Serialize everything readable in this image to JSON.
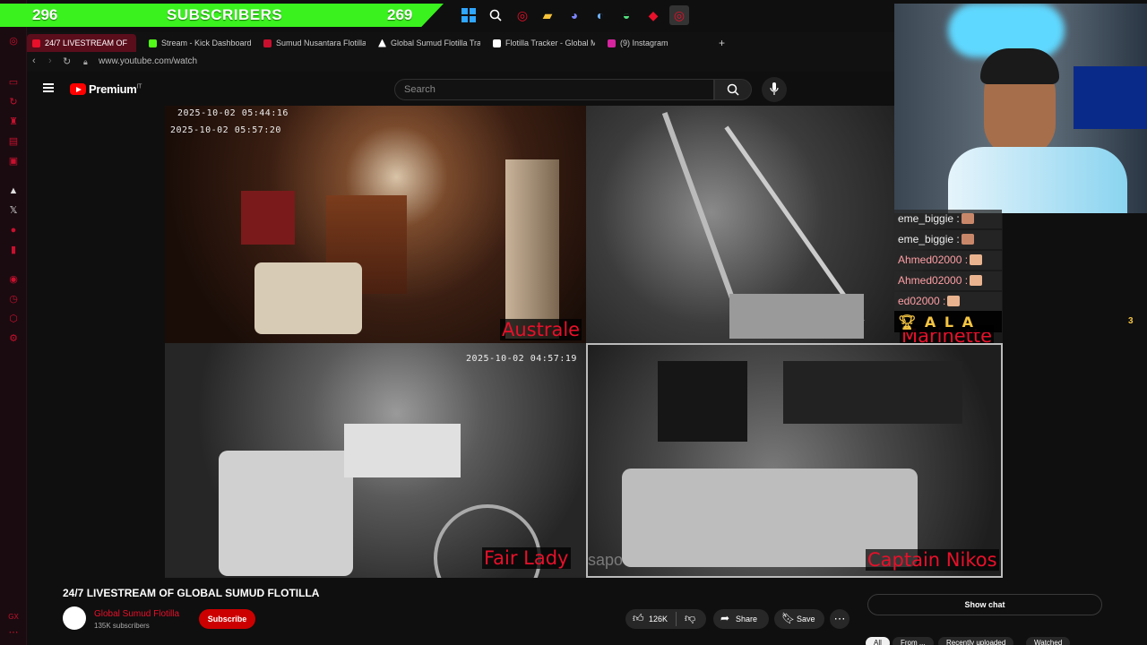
{
  "sub_bar": {
    "left_count": "296",
    "label": "SUBSCRIBERS",
    "right_count": "269"
  },
  "tabs": [
    {
      "label": "24/7 LIVESTREAM OF",
      "icon": "speaker-icon"
    },
    {
      "label": "Stream - Kick Dashboard",
      "icon": "kick-icon"
    },
    {
      "label": "Sumud Nusantara Flotilla",
      "icon": "flotilla-icon"
    },
    {
      "label": "Global Sumud Flotilla Tra",
      "icon": "triangle-icon"
    },
    {
      "label": "Flotilla Tracker - Global M",
      "icon": "page-icon"
    },
    {
      "label": "(9) Instagram",
      "icon": "instagram-icon"
    }
  ],
  "address": {
    "url": "www.youtube.com/watch"
  },
  "youtube": {
    "brand": "Premium",
    "brand_sup": "IT",
    "search_placeholder": "Search"
  },
  "video": {
    "cams": {
      "top_left": {
        "ts1": "2025-10-02 05:44:16",
        "ts2": "2025-10-02 05:57:20",
        "name": "Australe"
      },
      "top_right": {
        "name": "Marinette"
      },
      "bottom_left": {
        "ts": "2025-10-02 04:57:19",
        "name": "Fair Lady"
      },
      "bottom_right": {
        "name": "Captain Nikos"
      }
    },
    "watermark": "sapo"
  },
  "chat_overlay": {
    "messages": [
      {
        "user": "eme_biggie :"
      },
      {
        "user": "eme_biggie :"
      },
      {
        "user": "Ahmed02000 :"
      },
      {
        "user": "Ahmed02000 :"
      },
      {
        "user": "ed02000 :"
      }
    ],
    "leader": "A L A",
    "leader_count": "3"
  },
  "video_title": "24/7 LIVESTREAM OF GLOBAL SUMUD FLOTILLA",
  "channel": {
    "name": "Global Sumud Flotilla",
    "subs": "135K subscribers",
    "subscribe": "Subscribe"
  },
  "actions": {
    "likes": "126K",
    "share": "Share",
    "save": "Save"
  },
  "show_chat": "Show chat",
  "chips": [
    "All",
    "From ...",
    "Recently uploaded",
    "Watched"
  ]
}
